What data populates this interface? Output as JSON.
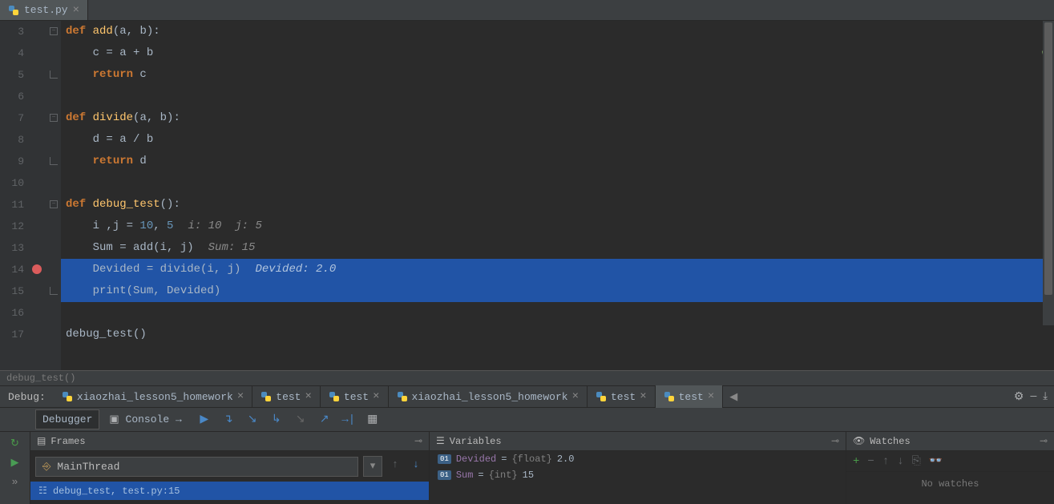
{
  "editor": {
    "tab_name": "test.py",
    "lines": [
      {
        "n": 3,
        "html": "<span class='kw'>def</span> <span class='fn'>add</span>(a, b):",
        "fold": true
      },
      {
        "n": 4,
        "html": "    c = a + b"
      },
      {
        "n": 5,
        "html": "    <span class='kw'>return</span> c",
        "fold_end": true
      },
      {
        "n": 6,
        "html": ""
      },
      {
        "n": 7,
        "html": "<span class='kw'>def</span> <span class='fn'>divide</span>(a, b):",
        "fold": true
      },
      {
        "n": 8,
        "html": "    d = a / b"
      },
      {
        "n": 9,
        "html": "    <span class='kw'>return</span> d",
        "fold_end": true
      },
      {
        "n": 10,
        "html": ""
      },
      {
        "n": 11,
        "html": "<span class='kw'>def</span> <span class='fn'>debug_test</span>():",
        "fold": true
      },
      {
        "n": 12,
        "html": "    i ,j = <span class='num'>10</span>, <span class='num'>5</span>",
        "hint": "i: 10  j: 5"
      },
      {
        "n": 13,
        "html": "    Sum = add(i, j)",
        "hint": "Sum: 15"
      },
      {
        "n": 14,
        "html": "    Devided = divide(i, j)",
        "hint": "Devided: 2.0",
        "bp": true,
        "exec": true
      },
      {
        "n": 15,
        "html": "    print(Sum, Devided)",
        "exec": true,
        "fold_end": true
      },
      {
        "n": 16,
        "html": ""
      },
      {
        "n": 17,
        "html": "debug_test()"
      }
    ],
    "stack_hint": "debug_test()"
  },
  "debug": {
    "label": "Debug:",
    "tabs": [
      {
        "name": "xiaozhai_lesson5_homework",
        "active": false
      },
      {
        "name": "test",
        "active": false
      },
      {
        "name": "test",
        "active": false
      },
      {
        "name": "xiaozhai_lesson5_homework",
        "active": false
      },
      {
        "name": "test",
        "active": false
      },
      {
        "name": "test",
        "active": true
      }
    ],
    "debugger_tab": "Debugger",
    "console_tab": "Console",
    "frames_label": "Frames",
    "variables_label": "Variables",
    "watches_label": "Watches",
    "main_thread": "MainThread",
    "frame_entry": "debug_test, test.py:15",
    "vars": [
      {
        "name": "Devided",
        "type": "{float}",
        "val": "2.0"
      },
      {
        "name": "Sum",
        "type": "{int}",
        "val": "15"
      }
    ],
    "no_watches": "No watches"
  }
}
